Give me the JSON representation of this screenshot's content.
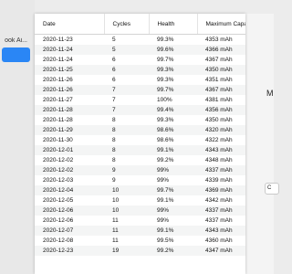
{
  "sidebar": {
    "title": "ook Ai..."
  },
  "right": {
    "heading": "M",
    "button": "C"
  },
  "table": {
    "headers": [
      "Date",
      "Cycles",
      "Health",
      "Maximum Capacity"
    ],
    "rows": [
      [
        "2020-11-23",
        "5",
        "99.3%",
        "4353 mAh"
      ],
      [
        "2020-11-24",
        "5",
        "99.6%",
        "4366 mAh"
      ],
      [
        "2020-11-24",
        "6",
        "99.7%",
        "4367 mAh"
      ],
      [
        "2020-11-25",
        "6",
        "99.3%",
        "4350 mAh"
      ],
      [
        "2020-11-26",
        "6",
        "99.3%",
        "4351 mAh"
      ],
      [
        "2020-11-26",
        "7",
        "99.7%",
        "4367 mAh"
      ],
      [
        "2020-11-27",
        "7",
        "100%",
        "4381 mAh"
      ],
      [
        "2020-11-28",
        "7",
        "99.4%",
        "4356 mAh"
      ],
      [
        "2020-11-28",
        "8",
        "99.3%",
        "4350 mAh"
      ],
      [
        "2020-11-29",
        "8",
        "98.6%",
        "4320 mAh"
      ],
      [
        "2020-11-30",
        "8",
        "98.6%",
        "4322 mAh"
      ],
      [
        "2020-12-01",
        "8",
        "99.1%",
        "4343 mAh"
      ],
      [
        "2020-12-02",
        "8",
        "99.2%",
        "4348 mAh"
      ],
      [
        "2020-12-02",
        "9",
        "99%",
        "4337 mAh"
      ],
      [
        "2020-12-03",
        "9",
        "99%",
        "4339 mAh"
      ],
      [
        "2020-12-04",
        "10",
        "99.7%",
        "4369 mAh"
      ],
      [
        "2020-12-05",
        "10",
        "99.1%",
        "4342 mAh"
      ],
      [
        "2020-12-06",
        "10",
        "99%",
        "4337 mAh"
      ],
      [
        "2020-12-06",
        "11",
        "99%",
        "4337 mAh"
      ],
      [
        "2020-12-07",
        "11",
        "99.1%",
        "4343 mAh"
      ],
      [
        "2020-12-08",
        "11",
        "99.5%",
        "4360 mAh"
      ],
      [
        "2020-12-23",
        "19",
        "99.2%",
        "4347 mAh"
      ]
    ]
  }
}
